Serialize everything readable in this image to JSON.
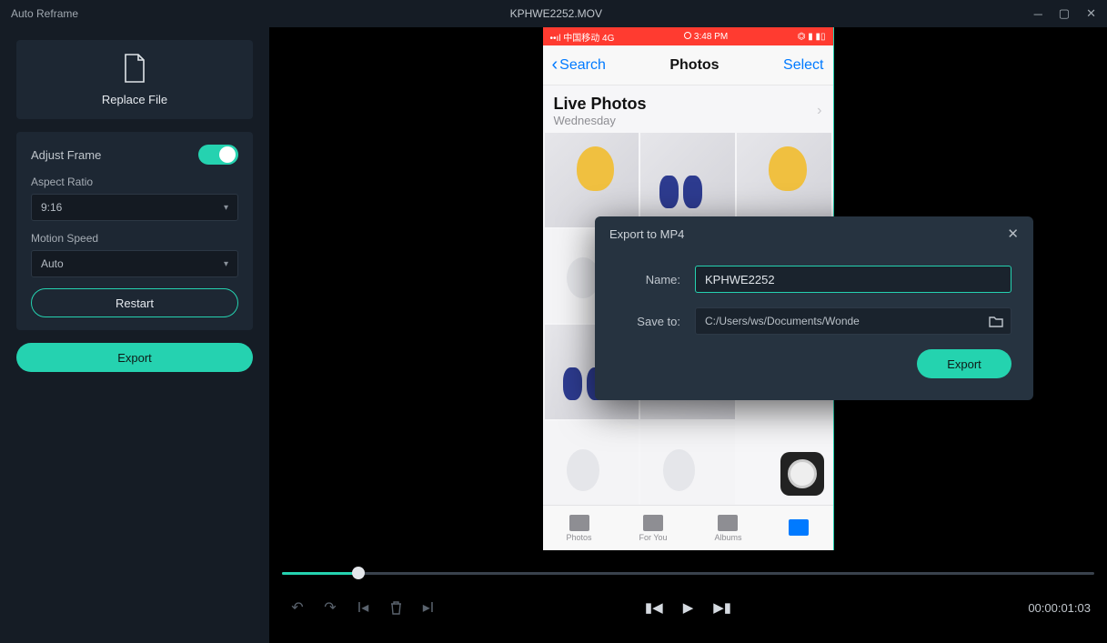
{
  "titlebar": {
    "app": "Auto Reframe",
    "file": "KPHWE2252.MOV"
  },
  "sidebar": {
    "replace_file": "Replace File",
    "adjust_frame": "Adjust Frame",
    "aspect_ratio_label": "Aspect Ratio",
    "aspect_ratio_value": "9:16",
    "motion_speed_label": "Motion Speed",
    "motion_speed_value": "Auto",
    "restart": "Restart",
    "export": "Export"
  },
  "playback": {
    "time": "00:00:01:03"
  },
  "modal": {
    "title": "Export to MP4",
    "name_label": "Name:",
    "name_value": "KPHWE2252",
    "save_to_label": "Save to:",
    "save_to_value": "C:/Users/ws/Documents/Wonde",
    "export": "Export"
  },
  "phone": {
    "carrier": "中国移动  4G",
    "time": "3:48 PM",
    "back": "Search",
    "title": "Photos",
    "select": "Select",
    "section_title": "Live Photos",
    "section_sub": "Wednesday",
    "tabs": [
      "Photos",
      "For You",
      "Albums",
      ""
    ]
  }
}
